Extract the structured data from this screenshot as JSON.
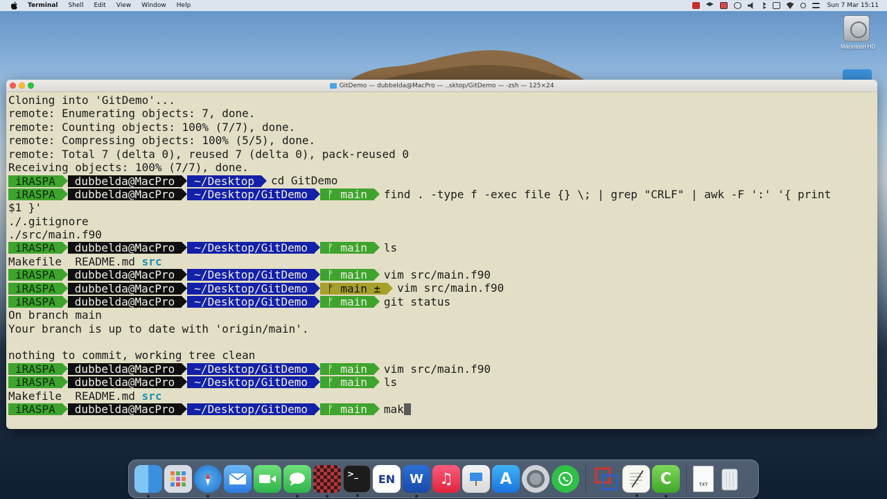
{
  "menubar": {
    "app_name": "Terminal",
    "menus": [
      "Shell",
      "Edit",
      "View",
      "Window",
      "Help"
    ],
    "clock": "Sun 7 Mar  15:11",
    "tray_icons": [
      "app-red-icon",
      "dropbox-icon",
      "screen-mirror-icon",
      "play-icon",
      "volume-icon",
      "bluetooth-icon",
      "airplay-icon",
      "wifi-icon",
      "search-icon",
      "control-center-icon"
    ]
  },
  "desktop": {
    "drive_label": "Macintosh HD"
  },
  "window": {
    "title": "GitDemo — dubbelda@MacPro — ..sktop/GitDemo — -zsh — 125×24"
  },
  "prompt": {
    "host": "iRASPA",
    "user": "dubbelda@MacPro",
    "path_desktop": "~/Desktop",
    "path_repo": "~/Desktop/GitDemo",
    "branch": "main",
    "branch_dirty": "main ±",
    "branch_glyph": "ᚠ"
  },
  "terminal": {
    "l1": "Cloning into 'GitDemo'...",
    "l2": "remote: Enumerating objects: 7, done.",
    "l3": "remote: Counting objects: 100% (7/7), done.",
    "l4": "remote: Compressing objects: 100% (5/5), done.",
    "l5": "remote: Total 7 (delta 0), reused 7 (delta 0), pack-reused 0",
    "l6": "Receiving objects: 100% (7/7), done.",
    "cmd_cd": "cd GitDemo",
    "cmd_find": "find . -type f -exec file {} \\; | grep \"CRLF\" | awk -F ':' '{ print",
    "find_cont": "$1 }'",
    "out_gitignore": "./.gitignore",
    "out_mainf90": "./src/main.f90",
    "cmd_ls": "ls",
    "ls_files": "Makefile  README.md ",
    "ls_dir": "src",
    "cmd_vim": "vim src/main.f90",
    "cmd_git_status": "git status",
    "status_1": "On branch main",
    "status_2": "Your branch is up to date with 'origin/main'.",
    "status_3": "nothing to commit, working tree clean",
    "cmd_current": "mak"
  },
  "dock": {
    "apps": [
      "Finder",
      "Launchpad",
      "Safari",
      "Mail",
      "FaceTime",
      "Messages",
      "Photo Booth",
      "Terminal",
      "EN",
      "Word",
      "Music",
      "Keynote",
      "App Store",
      "System Preferences",
      "WhatsApp",
      "Parallels",
      "TextEdit",
      "Camtasia",
      "Text Document",
      "Trash"
    ],
    "labels": {
      "terminal": ">_",
      "en": "EN",
      "word": "W",
      "music": "♫",
      "appstore": "A",
      "txt": "TXT"
    }
  },
  "colors": {
    "terminal_bg": "#e3dfc6",
    "host_green": "#3ea42d",
    "path_blue": "#1320a8",
    "user_black": "#0f0f0f",
    "dirty_olive": "#a7a02a"
  }
}
